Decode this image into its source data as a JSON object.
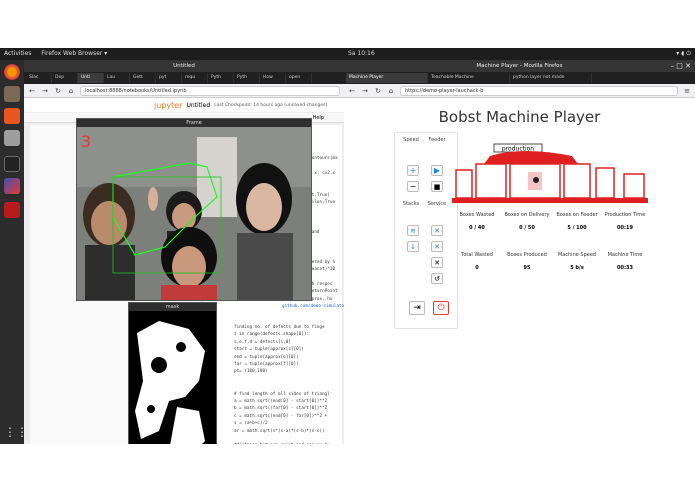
{
  "topbar_left": {
    "activities": "Activities",
    "app": "Firefox Web Browser ▾"
  },
  "topbar_right": {
    "time": "Sa 10:16"
  },
  "left_window": {
    "title": "Untitled",
    "tabs": [
      "Slac",
      "Dep",
      "Unti",
      "Lau",
      "Gett",
      "pyt",
      "requ",
      "Pyth",
      "Pyth",
      "How",
      "open"
    ],
    "url": "localhost:8888/notebooks/Untitled.ipynb",
    "notebook_name": "Untitled",
    "checkpoint": "Last Checkpoint: 14 hours ago  (unsaved changes)",
    "logo_text": "jupyter",
    "code_top": [
      "ndContours(ma",
      "",
      "ddx x: cv2.c",
      "",
      "",
      "hcnt,True)",
      "epsilon,True",
      "",
      "",
      "",
      "e hand",
      "ll)",
      "l)",
      "",
      "covered by h",
      "/areacnt)*10",
      "",
      "with respec",
      "; returnPoint",
      "(approx, hu"
    ],
    "code_bottom": [
      "finding no. of defects due to finge",
      "i in range(defects.shape[0]):",
      "s,e,f,d = defects[i,0]",
      "start = tuple(approx[s][0])",
      "end = tuple(approx[e][0])",
      "far = tuple(approx[f][0])",
      "pt= (100,180)",
      "",
      "",
      "# find length of all sides of triangl",
      "a = math.sqrt((end[0] - start[0])**2",
      "b = math.sqrt((far[0] - start[0])**2",
      "c = math.sqrt((end[0] - far[0])**2 +",
      "s = (a+b+c)/2",
      "ar = math.sqrt(s*(s-a)*(s-b)*(s-c))",
      "",
      "#distance between point and convex hu",
      "d=(2*ar)/a",
      "",
      "# apply cosine rule here",
      "angle = math.acos((b**2 + c**2 - a**2"
    ],
    "url_snippet": "github.com/demo-simulator-lausc",
    "help_label": "Help"
  },
  "frame_window": {
    "title": "Frame",
    "overlay_number": "3"
  },
  "mask_window": {
    "title": "mask"
  },
  "right_window": {
    "title": "Machine Player - Mozilla Firefox",
    "tabs": [
      "Machine Player",
      "Teachable Machine",
      "python layer not made"
    ],
    "url": "https://demo-player-lauchack-b",
    "heading": "Bobst Machine Player",
    "machine_label": "production",
    "controls": {
      "speed_label": "Speed",
      "feeder_label": "Feeder",
      "stacks_label": "Stacks",
      "service_label": "Service"
    },
    "stats_row1": [
      {
        "label": "Boxes Wasted",
        "value": "0 / 40"
      },
      {
        "label": "Boxes on Delivery",
        "value": "0 / 50"
      },
      {
        "label": "Boxes on Feeder",
        "value": "5 / 100"
      },
      {
        "label": "Production Time",
        "value": "00:19"
      }
    ],
    "stats_row2": [
      {
        "label": "Total Wasted",
        "value": "0"
      },
      {
        "label": "Boxes Produced",
        "value": "95"
      },
      {
        "label": "Machine Speed",
        "value": "5 b/s"
      },
      {
        "label": "Machine Time",
        "value": "00:33"
      }
    ]
  },
  "colors": {
    "accent_blue": "#1e88e5",
    "power_red": "#e53935",
    "machine_red": "#e02020"
  }
}
